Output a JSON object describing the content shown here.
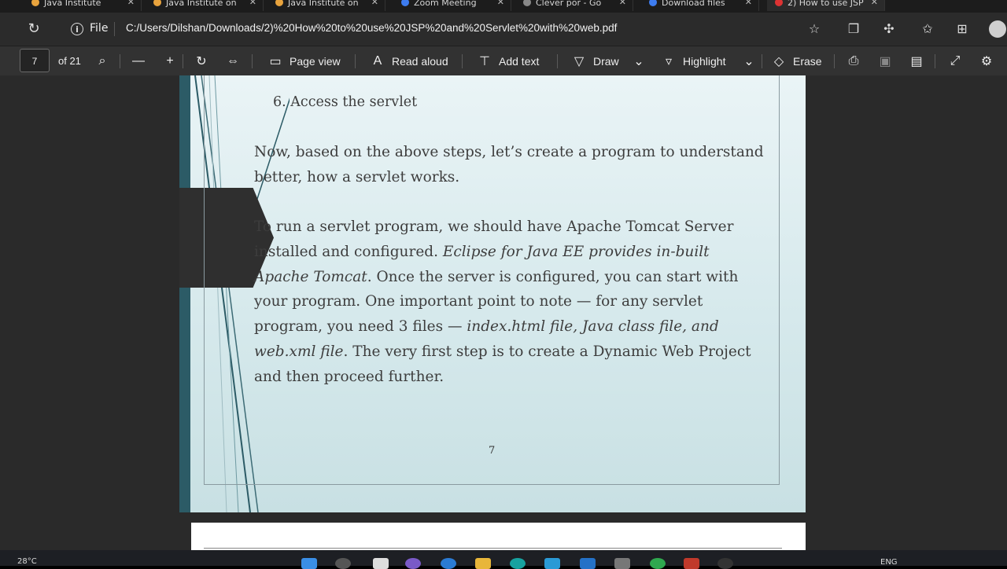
{
  "browser": {
    "tabs": [
      {
        "label": "Java Institute"
      },
      {
        "label": "Java Institute on"
      },
      {
        "label": "Java Institute on"
      },
      {
        "label": "Zoom Meeting"
      },
      {
        "label": "Clever por - Go"
      },
      {
        "label": "Download files"
      },
      {
        "label": "2) How to use JSP"
      }
    ],
    "address": {
      "scheme_label": "File",
      "url": "C:/Users/Dilshan/Downloads/2)%20How%20to%20use%20JSP%20and%20Servlet%20with%20web.pdf"
    }
  },
  "pdf_toolbar": {
    "page_current": "7",
    "page_total": "of 21",
    "page_view": "Page view",
    "read_aloud": "Read aloud",
    "add_text": "Add text",
    "draw": "Draw",
    "highlight": "Highlight",
    "erase": "Erase"
  },
  "document": {
    "step6": "6. Access the servlet",
    "para1_line1": "Now, based on the above steps, let’s create a program to understand",
    "para1_line2": "better, how a servlet works.",
    "para2_line1": "To run a servlet program, we should have Apache Tomcat Server",
    "para2_line2_a": "installed and configured. ",
    "para2_line2_b": "Eclipse for Java EE provides in-built",
    "para2_line3_a": "Apache Tomcat",
    "para2_line3_b": ". Once the server is configured, you can start with",
    "para2_line4": "your program. One important point to note — for any servlet",
    "para2_line5_a": "program, you need 3 files — ",
    "para2_line5_b": "index.html file, Java class file, and",
    "para2_line6_a": "web.xml file",
    "para2_line6_b": ". The very first step is to create a Dynamic Web Project",
    "para2_line7": "and then proceed further.",
    "page_number": "7"
  },
  "taskbar": {
    "weather": "28°C",
    "language": "ENG"
  }
}
